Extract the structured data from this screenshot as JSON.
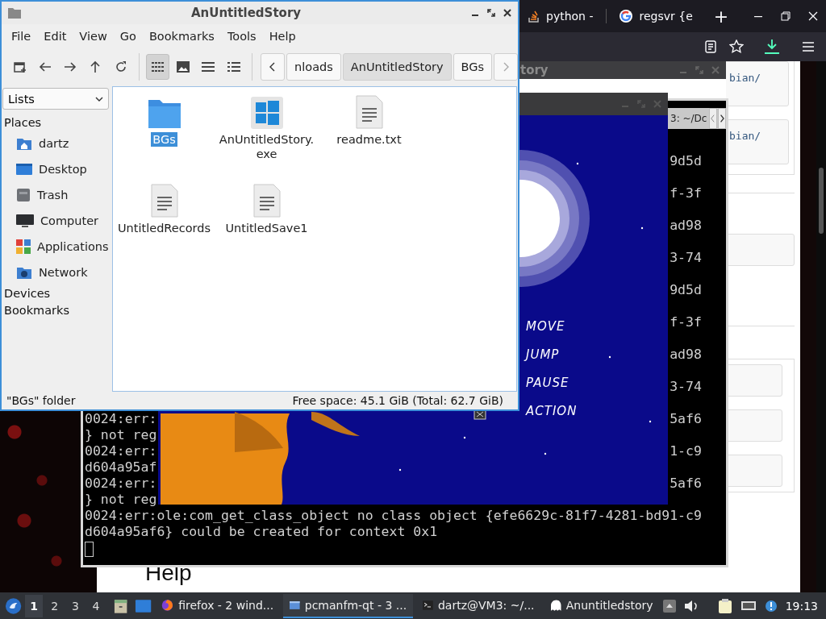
{
  "browser": {
    "tabs": [
      {
        "label": "python -",
        "kind": "stack"
      },
      {
        "label": "regsvr {e",
        "kind": "search"
      }
    ],
    "new_tab": "+",
    "page": {
      "code_snippets": [
        "bian/",
        "bian/"
      ],
      "heading": "Help"
    }
  },
  "back_window": {
    "title": "tory"
  },
  "terminal": {
    "tab": "3: ~/Dc",
    "lines": [
      {
        "right": "9d5d"
      },
      {
        "right": "f-3f"
      },
      {
        "right": "ad98"
      },
      {
        "right": "3-74"
      },
      {
        "right": "9d5d"
      },
      {
        "right": "f-3f"
      },
      {
        "right": "ad98"
      },
      {
        "right": "3-74"
      },
      {
        "left": "0024:err:",
        "right": "5af6"
      },
      {
        "left": "} not reg"
      },
      {
        "left": "0024:err:",
        "right": "1-c9"
      },
      {
        "left": "d604a95af"
      },
      {
        "left": "0024:err:",
        "right": "5af6"
      },
      {
        "left": "} not reg"
      },
      {
        "left": "0024:err:ole:com_get_class_object no class object {efe6629c-81f7-4281-bd91-c9"
      },
      {
        "left": "d604a95af6} could be created for context 0x1"
      }
    ]
  },
  "game": {
    "menu": [
      "MOVE",
      "JUMP",
      "PAUSE",
      "ACTION"
    ]
  },
  "file_manager": {
    "title": "AnUntitledStory",
    "menu": [
      "File",
      "Edit",
      "View",
      "Go",
      "Bookmarks",
      "Tools",
      "Help"
    ],
    "view_modes": [
      {
        "kind": "icons",
        "selected": true
      },
      {
        "kind": "thumbnails",
        "selected": false
      },
      {
        "kind": "compact",
        "selected": false
      },
      {
        "kind": "details",
        "selected": false
      }
    ],
    "path": [
      {
        "label": "nloads",
        "selected": false
      },
      {
        "label": "AnUntitledStory",
        "selected": true
      },
      {
        "label": "BGs",
        "selected": false
      }
    ],
    "pane_mode": "Lists",
    "places_heading": "Places",
    "places": [
      {
        "label": "dartz",
        "kind": "home"
      },
      {
        "label": "Desktop",
        "kind": "desktop"
      },
      {
        "label": "Trash",
        "kind": "trash"
      },
      {
        "label": "Computer",
        "kind": "computer"
      },
      {
        "label": "Applications",
        "kind": "applications"
      },
      {
        "label": "Network",
        "kind": "network"
      }
    ],
    "sections": [
      "Devices",
      "Bookmarks"
    ],
    "files": [
      {
        "name": "BGs",
        "kind": "folder",
        "selected": true
      },
      {
        "name": "AnUntitledStory.exe",
        "kind": "exe",
        "selected": false
      },
      {
        "name": "readme.txt",
        "kind": "text",
        "selected": false
      },
      {
        "name": "UntitledRecords",
        "kind": "text",
        "selected": false
      },
      {
        "name": "UntitledSave1",
        "kind": "text",
        "selected": false
      }
    ],
    "status": "\"BGs\" folder",
    "free_space": "Free space: 45.1 GiB (Total: 62.7 GiB)"
  },
  "taskbar": {
    "workspaces": [
      {
        "label": "1",
        "selected": true
      },
      {
        "label": "2",
        "selected": false
      },
      {
        "label": "3",
        "selected": false
      },
      {
        "label": "4",
        "selected": false
      }
    ],
    "tasks": [
      {
        "label": "firefox - 2 wind...",
        "kind": "browser",
        "selected": false
      },
      {
        "label": "pcmanfm-qt - 3 ...",
        "kind": "folder",
        "selected": true
      },
      {
        "label": "dartz@VM3: ~/...",
        "kind": "terminal",
        "selected": false
      },
      {
        "label": "Anuntitledstory",
        "kind": "app",
        "selected": false
      }
    ],
    "clock": "19:13"
  }
}
